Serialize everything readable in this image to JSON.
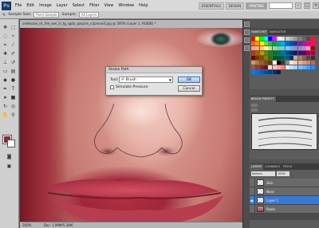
{
  "menubar": {
    "logo": "Ps",
    "items": [
      "File",
      "Edit",
      "Image",
      "Layer",
      "Select",
      "Filter",
      "View",
      "Window",
      "Help"
    ],
    "workspaces": [
      "ESSENTIALS",
      "DESIGN",
      "PAINTING"
    ],
    "window_controls": [
      "–",
      "□",
      "×"
    ]
  },
  "optionsbar": {
    "sample_size_label": "Sample Size:",
    "sample_size_value": "Point Sample",
    "sample_label": "Sample:",
    "sample_value": "All Layers"
  },
  "document": {
    "tab_title": "ondesose_ist_the_wei_ili_tg_sgda_qaspire_n2prssw3.jpg @ 300% (Layer 1, RGB/8) *",
    "zoom": "300%",
    "doc_size": "Doc: 1.99M/5.34M"
  },
  "dialog": {
    "title": "Stroke Path",
    "tool_label": "Tool:",
    "tool_value": "Brush",
    "simulate_pressure": "Simulate Pressure",
    "ok": "OK",
    "cancel": "Cancel"
  },
  "panels": {
    "swatches_tabs": [
      "SWATCHES",
      "NAVIGATOR"
    ],
    "brush_tab": "BRUSH PRESETS",
    "layers_tabs": [
      "LAYERS",
      "CHANNELS",
      "PATHS"
    ],
    "blend_mode": "Normal",
    "opacity": "100%",
    "layers": [
      {
        "name": "Skin",
        "visible": "",
        "active": false,
        "thumb": "transparent"
      },
      {
        "name": "Nose",
        "visible": "",
        "active": false,
        "thumb": "transparent"
      },
      {
        "name": "Layer 1",
        "visible": "●",
        "active": true,
        "thumb": "transparent"
      },
      {
        "name": "Roots",
        "visible": "",
        "active": false,
        "thumb": "photo"
      }
    ]
  },
  "colors": {
    "foreground": "#8b2a2a",
    "background": "#ffffff",
    "active_layer": "#3a78d6"
  }
}
